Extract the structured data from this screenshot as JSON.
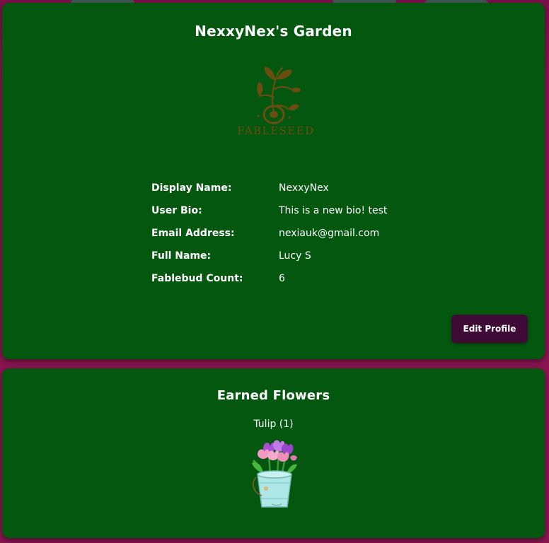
{
  "profile": {
    "title": "NexxyNex's Garden",
    "logo_text": "FABLESEED",
    "fields": [
      {
        "label": "Display Name:",
        "value": "NexxyNex"
      },
      {
        "label": "User Bio:",
        "value": "This is a new bio! test"
      },
      {
        "label": "Email Address:",
        "value": "nexiauk@gmail.com"
      },
      {
        "label": "Full Name:",
        "value": "Lucy S"
      },
      {
        "label": "Fablebud Count:",
        "value": "6"
      }
    ],
    "edit_button": "Edit Profile"
  },
  "flowers": {
    "title": "Earned Flowers",
    "items": [
      {
        "name": "Tulip (1)",
        "icon": "tulip-bucket-icon"
      }
    ]
  },
  "colors": {
    "background": "#8a1550",
    "card": "#04570f",
    "button": "#3d0b35",
    "logo": "#6b4d12"
  }
}
